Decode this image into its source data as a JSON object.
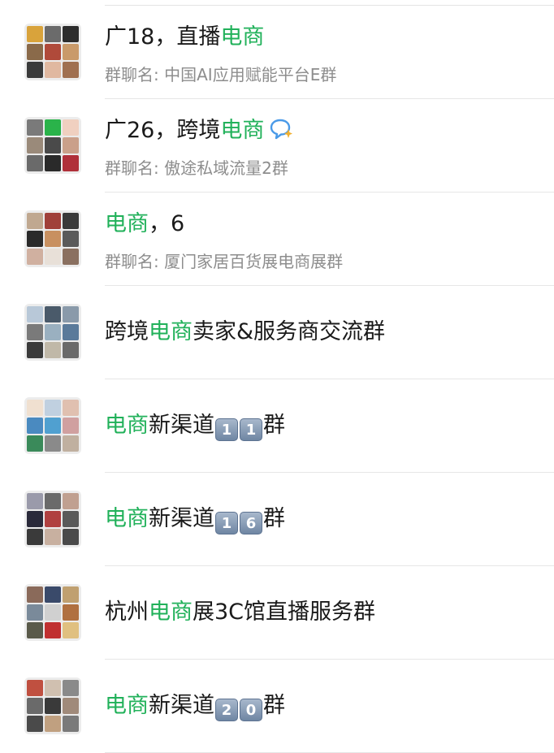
{
  "highlight_color": "#21b15a",
  "keyword": "电商",
  "results": [
    {
      "avatar": [
        "#d9a33b",
        "#6b6b6b",
        "#2d2d2d",
        "#8a6a4a",
        "#b04a3a",
        "#c99a6a",
        "#3a3a3a",
        "#e0b8a0",
        "#a07050"
      ],
      "title_pre": "广18，直播",
      "title_hl": "电商",
      "title_post": "",
      "subtitle_label": "群聊名: ",
      "subtitle_text": "中国AI应用赋能平台E群"
    },
    {
      "avatar": [
        "#7a7a7a",
        "#2ab34a",
        "#f0d0c0",
        "#9a8a7a",
        "#4a4a4a",
        "#caa08a",
        "#6a6a6a",
        "#2a2a2a",
        "#b0303a"
      ],
      "title_pre": "广26，跨境",
      "title_hl": "电商",
      "title_post": "",
      "icon": "chat-bubble-sparkle-icon",
      "subtitle_label": "群聊名: ",
      "subtitle_text": "傲途私域流量2群"
    },
    {
      "avatar": [
        "#c0a890",
        "#a0403a",
        "#3a3a3a",
        "#2a2a2a",
        "#c89060",
        "#5a5a5a",
        "#d0b0a0",
        "#e8e0d8",
        "#8a7060"
      ],
      "title_pre": "",
      "title_hl": "电商",
      "title_post": "，6",
      "subtitle_label": "群聊名: ",
      "subtitle_text": "厦门家居百货展电商展群"
    },
    {
      "avatar": [
        "#b8c8d8",
        "#4a5a6a",
        "#8a9aaa",
        "#7a7a7a",
        "#9ab0c0",
        "#5a7a9a",
        "#3a3a3a",
        "#c0b8a8",
        "#6a6a6a"
      ],
      "title_pre": "跨境",
      "title_hl": "电商",
      "title_post": "卖家&服务商交流群"
    },
    {
      "avatar": [
        "#f0e0d0",
        "#c0d0e0",
        "#e0c0b0",
        "#4a8ac0",
        "#50a0d0",
        "#d0a0a0",
        "#3a8a5a",
        "#8a8a8a",
        "#c0b0a0"
      ],
      "title_pre": "",
      "title_hl": "电商",
      "title_post_a": "新渠道",
      "keycaps": [
        "1",
        "1"
      ],
      "title_post_b": "群"
    },
    {
      "avatar": [
        "#9a9aaa",
        "#6a6a6a",
        "#c0a090",
        "#2a2a3a",
        "#b04040",
        "#5a5a5a",
        "#3a3a3a",
        "#c8b0a0",
        "#4a4a4a"
      ],
      "title_pre": "",
      "title_hl": "电商",
      "title_post_a": "新渠道",
      "keycaps": [
        "1",
        "6"
      ],
      "title_post_b": "群"
    },
    {
      "avatar": [
        "#8a6a5a",
        "#3a4a6a",
        "#c0a070",
        "#7a8a9a",
        "#d0d0d0",
        "#b07040",
        "#5a5a4a",
        "#c03030",
        "#e0c080"
      ],
      "title_pre": "杭州",
      "title_hl": "电商",
      "title_post": "展3C馆直播服务群"
    },
    {
      "avatar": [
        "#c05040",
        "#d0c0b0",
        "#8a8a8a",
        "#6a6a6a",
        "#3a3a3a",
        "#a08a7a",
        "#4a4a4a",
        "#c0a080",
        "#7a7a7a"
      ],
      "title_pre": "",
      "title_hl": "电商",
      "title_post_a": "新渠道",
      "keycaps": [
        "2",
        "0"
      ],
      "title_post_b": "群"
    }
  ]
}
